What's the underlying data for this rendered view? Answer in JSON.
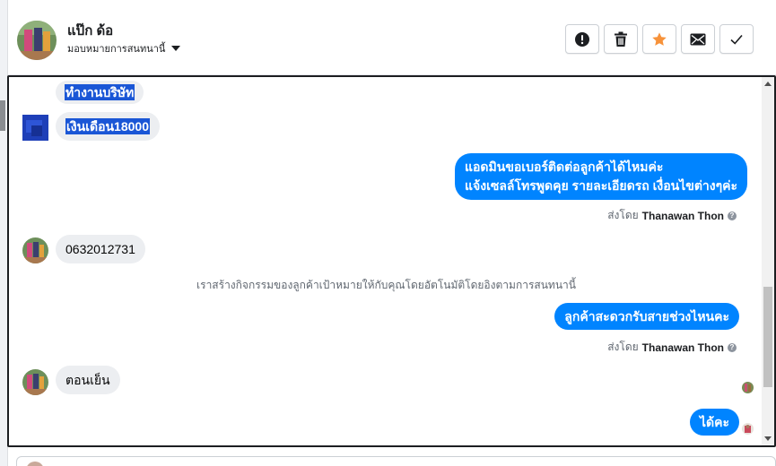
{
  "header": {
    "contact_name": "แป๊ก ด้อ",
    "assign_label": "มอบหมายการสนทนานี้",
    "actions": [
      {
        "name": "spam-button",
        "icon": "exclamation-circle-icon"
      },
      {
        "name": "delete-button",
        "icon": "trash-icon"
      },
      {
        "name": "star-button",
        "icon": "star-icon",
        "color": "#f7923a"
      },
      {
        "name": "mark-unread-button",
        "icon": "envelope-icon"
      },
      {
        "name": "mark-done-button",
        "icon": "checkmark-icon"
      }
    ]
  },
  "messages": {
    "m1": "ทำงานบริษัท",
    "m2": "เงินเดือน18000",
    "m3_line1": "แอดมินขอเบอร์ติดต่อลูกค้าได้ไหมค่ะ",
    "m3_line2": "แจ้งเซลล์โทรพูดคุย รายละเอียดรถ เงื่อนไขต่างๆค่ะ",
    "m4": "0632012731",
    "m5": "ลูกค้าสะดวกรับสายช่วงไหนคะ",
    "m6": "ตอนเย็น",
    "m7": "ได้คะ"
  },
  "sent_by": {
    "prefix": "ส่งโดย",
    "agent": "Thanawan Thon",
    "help": "?"
  },
  "system_note": "เราสร้างกิจกรรมของลูกค้าเป้าหมายให้กับคุณโดยอัตโนมัติโดยอิงตามการสนทนานี้",
  "colors": {
    "outgoing_bubble": "#0084ff",
    "incoming_bubble": "#eceef1",
    "text_selection": "#1a56d6"
  }
}
